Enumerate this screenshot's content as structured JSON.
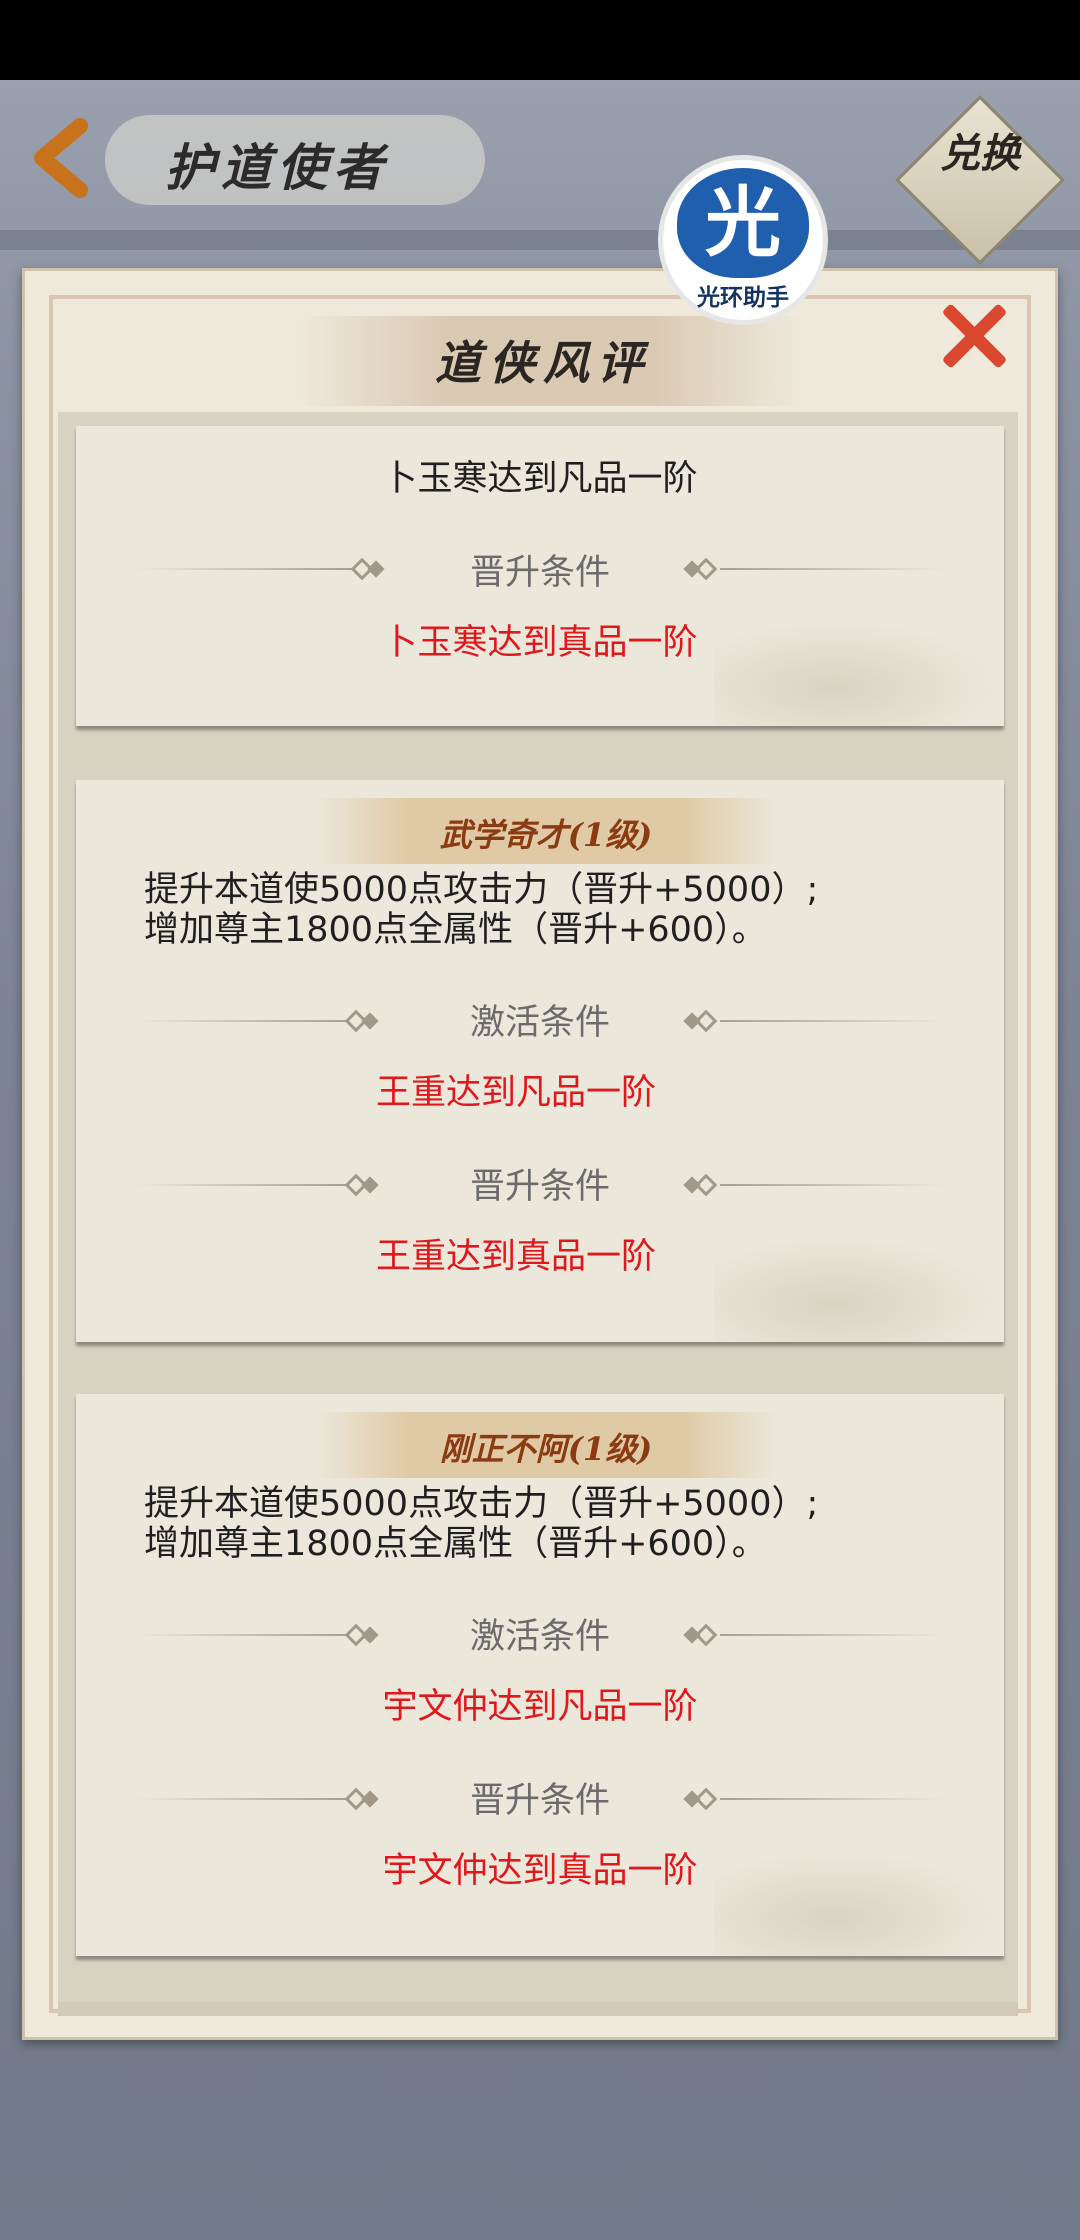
{
  "header": {
    "title": "护道使者",
    "redeem_label": "兑换"
  },
  "logo": {
    "glyph": "光",
    "caption": "光环助手"
  },
  "dialog": {
    "title": "道侠风评",
    "cards": [
      {
        "current": "卜玉寒达到凡品一阶",
        "promote_label": "晋升条件",
        "promote_condition": "卜玉寒达到真品一阶"
      },
      {
        "skill": "武学奇才(1级)",
        "desc_line1": "提升本道使5000点攻击力（晋升+5000）;",
        "desc_line2": "增加尊主1800点全属性（晋升+600）。",
        "activate_label": "激活条件",
        "activate_condition": "王重达到凡品一阶",
        "promote_label": "晋升条件",
        "promote_condition": "王重达到真品一阶"
      },
      {
        "skill": "刚正不阿(1级)",
        "desc_line1": "提升本道使5000点攻击力（晋升+5000）;",
        "desc_line2": "增加尊主1800点全属性（晋升+600）。",
        "activate_label": "激活条件",
        "activate_condition": "宇文仲达到凡品一阶",
        "promote_label": "晋升条件",
        "promote_condition": "宇文仲达到真品一阶"
      }
    ]
  },
  "colors": {
    "condition_red": "#e0171b",
    "skill_brown": "#8a3b12",
    "close_red": "#d9482f"
  }
}
